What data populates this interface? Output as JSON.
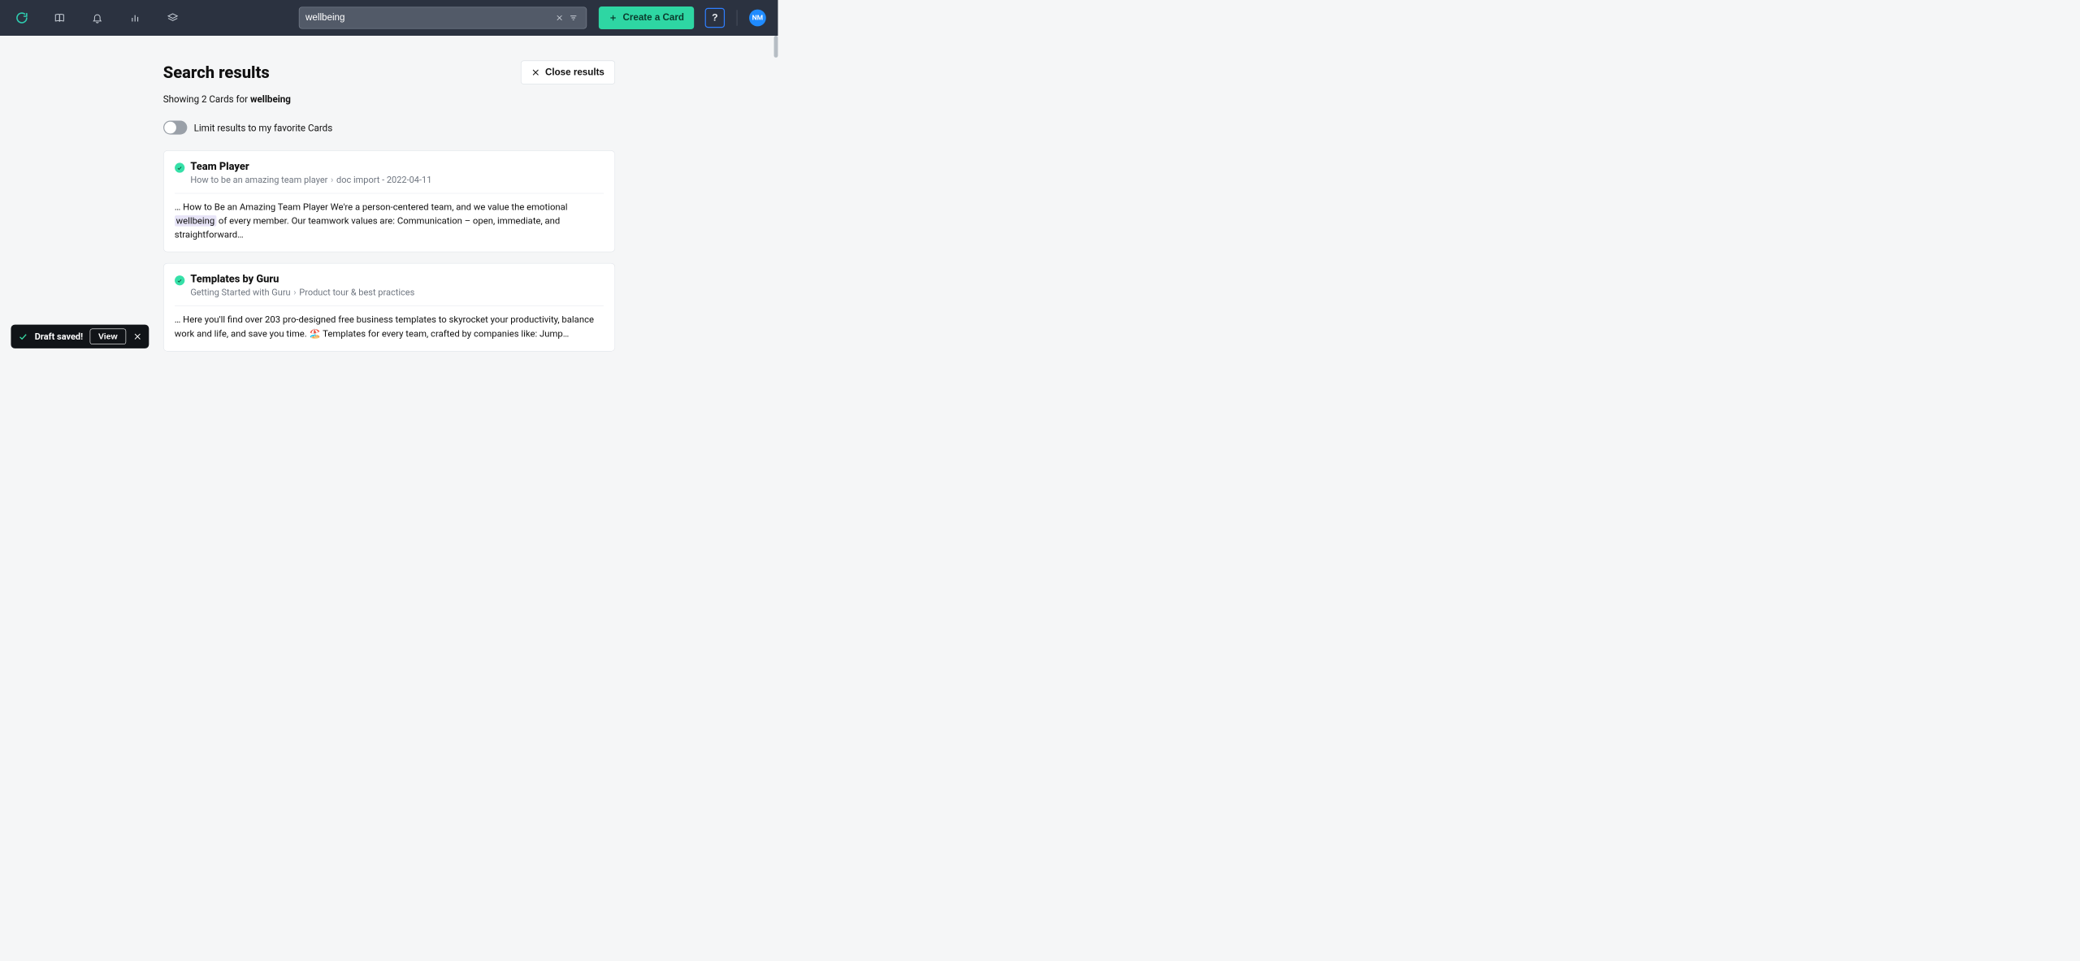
{
  "search": {
    "value": "wellbeing"
  },
  "header": {
    "create_label": "Create a Card",
    "help_label": "?",
    "avatar_initials": "NM"
  },
  "page": {
    "title": "Search results",
    "close_label": "Close results",
    "summary_prefix": "Showing 2 Cards for ",
    "summary_term": "wellbeing",
    "toggle_label": "Limit results to my favorite Cards"
  },
  "results": [
    {
      "title": "Team Player",
      "crumb_a": "How to be an amazing team player",
      "crumb_b": "doc import - 2022-04-11",
      "snippet_before": "… How to Be an Amazing Team Player We're a person-centered team, and we value the emotional ",
      "snippet_highlight": "wellbeing",
      "snippet_after": " of every member. Our teamwork values are: Communication – open, immediate, and straightforward…"
    },
    {
      "title": "Templates by Guru",
      "crumb_a": "Getting Started with Guru",
      "crumb_b": "Product tour & best practices",
      "snippet_before": "… Here you'll find over 203 pro-designed free business templates to skyrocket your productivity, balance work and life, and save you time. 🏖️ Templates for every team, crafted by companies like: Jump…",
      "snippet_highlight": "",
      "snippet_after": ""
    }
  ],
  "toast": {
    "message": "Draft saved!",
    "view_label": "View"
  }
}
